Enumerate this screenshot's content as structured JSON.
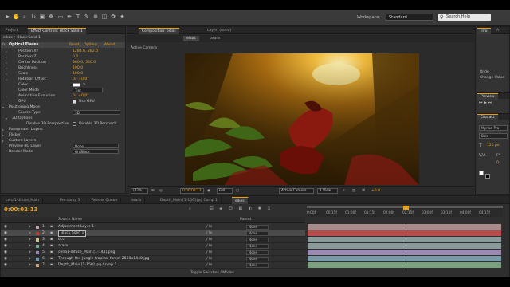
{
  "app": {
    "title": "After Effects"
  },
  "toolbar": {
    "workspace_label": "Workspace:",
    "workspace_value": "Standard",
    "search_placeholder": "Search Help"
  },
  "project_panel": {
    "tab": "Project"
  },
  "effect_controls": {
    "tab": "Effect Controls: Black Solid 1",
    "header": "eikos • Black Solid 1",
    "effect_name": "Optical Flares",
    "reset_label": "Reset",
    "options_label": "Options...",
    "about_label": "About...",
    "rows": [
      {
        "label": "Position XY",
        "value": "1284.6, 282.0"
      },
      {
        "label": "Position Z",
        "value": "0.0"
      },
      {
        "label": "Center Position",
        "value": "960.0, 540.0"
      },
      {
        "label": "Brightness",
        "value": "100.0"
      },
      {
        "label": "Scale",
        "value": "100.0"
      },
      {
        "label": "Rotation Offset",
        "value": "0x +0.0°"
      },
      {
        "label": "Color",
        "value": ""
      },
      {
        "label": "Color Mode",
        "value": "Tint"
      },
      {
        "label": "Animation Evolution",
        "value": "0x +0.0°"
      },
      {
        "label": "GPU",
        "value": "Use GPU"
      },
      {
        "label": "Positioning Mode",
        "value": ""
      },
      {
        "label": "Source Type",
        "value": "3D"
      },
      {
        "label": "3D Options",
        "value": ""
      },
      {
        "label": "Disable 3D Perspective",
        "value": "Disable 3D Perspecti"
      },
      {
        "label": "Foreground Layers",
        "value": ""
      },
      {
        "label": "Flicker",
        "value": ""
      },
      {
        "label": "Custom Layers",
        "value": ""
      },
      {
        "label": "Preview BG Layer",
        "value": "None"
      },
      {
        "label": "Render Mode",
        "value": "On Black"
      }
    ]
  },
  "composition": {
    "tab": "Composition: eikos",
    "layer_tab": "Layer: (none)",
    "breadcrumbs": [
      "eikos",
      "arara"
    ],
    "view_label": "Active Camera",
    "footer": {
      "zoom": "(72%)",
      "timecode": "0:00:02:13",
      "resolution": "Full",
      "camera": "Active Camera",
      "views": "1 View",
      "exposure": "+0.0"
    }
  },
  "right_panels": {
    "info_tab": "Info",
    "audio_tab": "A",
    "undo_label": "Undo",
    "undo_action": "Change Value",
    "preview_tab": "Preview",
    "character_tab": "Charact",
    "font": "Myriad Pro",
    "style": "Bold",
    "font_size": "125 px",
    "leading": "px",
    "tracking": "0"
  },
  "timeline": {
    "tabs": [
      "cena1-difuse_Main",
      "Pre-comp 1",
      "Render Queue",
      "arara",
      "Depth_Main.[1-150].jpg Comp 1",
      "eikos"
    ],
    "current_time": "0:00:02:13",
    "header": {
      "source_name": "Source Name",
      "parent": "Parent"
    },
    "layers": [
      {
        "num": "1",
        "name": "Adjustment Layer 1",
        "color": "#c0a0a0",
        "parent": "None",
        "bar": "#a88a8a"
      },
      {
        "num": "2",
        "name": "Black Solid 1",
        "color": "#b83b3b",
        "parent": "None",
        "bar": "#b84b4b"
      },
      {
        "num": "3",
        "name": "occ",
        "color": "#c8c08a",
        "parent": "None",
        "bar": "#8a9a9a"
      },
      {
        "num": "4",
        "name": "arara",
        "color": "#7aa88c",
        "parent": "None",
        "bar": "#8a9a9a"
      },
      {
        "num": "5",
        "name": "cena1-difuse_Main.[1-144].png",
        "color": "#8a8ab8",
        "parent": "None",
        "bar": "#9a8ab0"
      },
      {
        "num": "6",
        "name": "Through-the-Jungle-tropical-forest-2560x1440.jpg",
        "color": "#6a9ab8",
        "parent": "None",
        "bar": "#7a9aaa"
      },
      {
        "num": "7",
        "name": "Depth_Main.[1-150].jpg Comp 1",
        "color": "#c8a07a",
        "parent": "None",
        "bar": "#7aa080"
      }
    ],
    "ruler": [
      "0:00f",
      "00:15f",
      "01:00f",
      "01:15f",
      "02:00f",
      "02:15f",
      "03:00f",
      "03:15f",
      "04:00f",
      "04:15f"
    ],
    "footer": "Toggle Switches / Modes"
  }
}
